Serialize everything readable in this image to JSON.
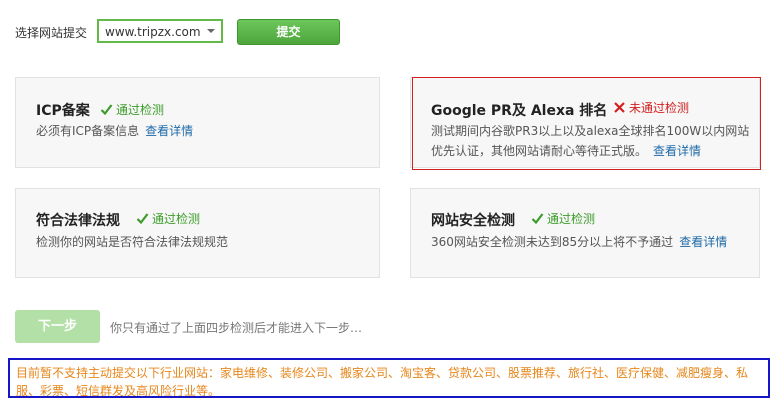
{
  "topbar": {
    "site_label": "选择网站提交",
    "site_select_value": "www.tripzx.com",
    "submit_label": "提交"
  },
  "cards": {
    "icp": {
      "title": "ICP备案",
      "status": "通过检测",
      "desc": "必须有ICP备案信息",
      "link": "查看详情"
    },
    "google": {
      "title": "Google PR及 Alexa 排名",
      "status": "未通过检测",
      "desc_line1": "测试期间内谷歌PR3以上以及alexa全球排名100W以内网站",
      "desc_line2": "优先认证，其他网站请耐心等待正式版。",
      "link": "查看详情"
    },
    "law": {
      "title": "符合法律法规",
      "status": "通过检测",
      "desc": "检测你的网站是否符合法律法规规范"
    },
    "safety": {
      "title": "网站安全检测",
      "status": "通过检测",
      "desc": "360网站安全检测未达到85分以上将不予通过",
      "link": "查看详情"
    }
  },
  "next": {
    "button_label": "下一步",
    "hint": "你只有通过了上面四步检测后才能进入下一步…"
  },
  "notice": {
    "text": "目前暂不支持主动提交以下行业网站：家电维修、装修公司、搬家公司、淘宝客、贷款公司、股票推荐、旅行社、医疗保健、减肥瘦身、私服、彩票、短信群发及高风险行业等。"
  },
  "colors": {
    "pass_green": "#3c9c2a",
    "fail_red": "#d21f1f",
    "link_blue": "#1f6aa8",
    "notice_orange": "#e7861a",
    "notice_border": "#1616c8"
  }
}
